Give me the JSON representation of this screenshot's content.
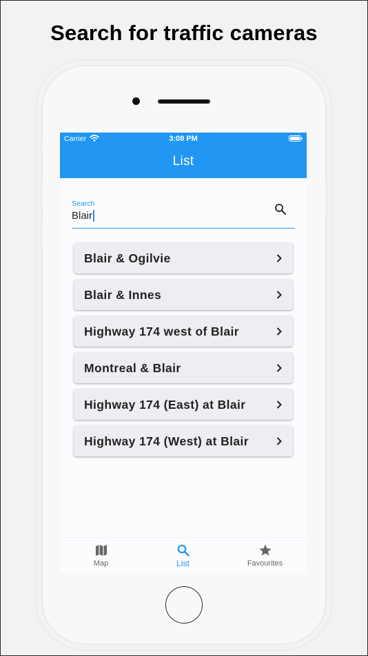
{
  "headline": "Search for traffic cameras",
  "status_bar": {
    "carrier": "Carrier",
    "time": "3:08 PM"
  },
  "app_bar": {
    "title": "List"
  },
  "search": {
    "label": "Search",
    "value": "Blair",
    "icon": "search-icon"
  },
  "results": [
    {
      "label": "Blair & Ogilvie"
    },
    {
      "label": "Blair & Innes"
    },
    {
      "label": "Highway 174 west of Blair"
    },
    {
      "label": "Montreal & Blair"
    },
    {
      "label": "Highway 174 (East) at Blair"
    },
    {
      "label": "Highway 174 (West) at Blair"
    }
  ],
  "bottom_nav": {
    "items": [
      {
        "label": "Map",
        "icon": "map-icon",
        "active": false
      },
      {
        "label": "List",
        "icon": "search-icon",
        "active": true
      },
      {
        "label": "Favourites",
        "icon": "star-icon",
        "active": false
      }
    ]
  },
  "colors": {
    "accent": "#2196f3",
    "card": "#efedf1",
    "screen_bg": "#fdfbfe"
  }
}
